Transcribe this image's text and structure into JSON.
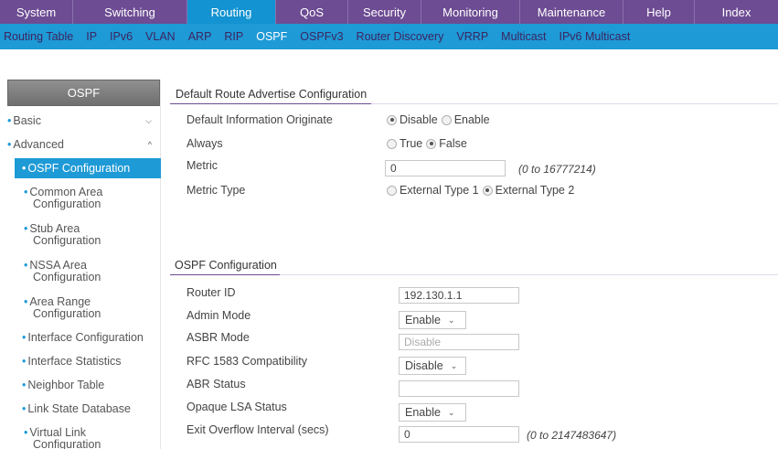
{
  "topnav": {
    "tabs": [
      {
        "label": "System",
        "width": 80,
        "active": false
      },
      {
        "label": "Switching",
        "width": 125,
        "active": false
      },
      {
        "label": "Routing",
        "width": 97,
        "active": true
      },
      {
        "label": "QoS",
        "width": 79,
        "active": false
      },
      {
        "label": "Security",
        "width": 80,
        "active": false
      },
      {
        "label": "Monitoring",
        "width": 108,
        "active": false
      },
      {
        "label": "Maintenance",
        "width": 113,
        "active": false
      },
      {
        "label": "Help",
        "width": 78,
        "active": false
      },
      {
        "label": "Index",
        "width": 91,
        "active": false
      }
    ]
  },
  "subnav": {
    "items": [
      {
        "label": "Routing Table",
        "active": false
      },
      {
        "label": "IP",
        "active": false
      },
      {
        "label": "IPv6",
        "active": false
      },
      {
        "label": "VLAN",
        "active": false
      },
      {
        "label": "ARP",
        "active": false
      },
      {
        "label": "RIP",
        "active": false
      },
      {
        "label": "OSPF",
        "active": true
      },
      {
        "label": "OSPFv3",
        "active": false
      },
      {
        "label": "Router Discovery",
        "active": false
      },
      {
        "label": "VRRP",
        "active": false
      },
      {
        "label": "Multicast",
        "active": false
      },
      {
        "label": "IPv6 Multicast",
        "active": false
      }
    ]
  },
  "sidebar": {
    "title": "OSPF",
    "basic": "Basic",
    "advanced": "Advanced",
    "items": [
      "OSPF Configuration",
      "Common Area Configuration",
      "Stub Area Configuration",
      "NSSA Area Configuration",
      "Area Range Configuration",
      "Interface Configuration",
      "Interface Statistics",
      "Neighbor Table",
      "Link State Database",
      "Virtual Link Configuration"
    ]
  },
  "default_route": {
    "title": "Default Route Advertise Configuration",
    "default_info_label": "Default Information Originate",
    "default_info_opt1": "Disable",
    "default_info_opt2": "Enable",
    "always_label": "Always",
    "always_opt1": "True",
    "always_opt2": "False",
    "metric_label": "Metric",
    "metric_value": "0",
    "metric_hint": "(0 to 16777214)",
    "metric_type_label": "Metric Type",
    "metric_type_opt1": "External Type 1",
    "metric_type_opt2": "External Type 2"
  },
  "ospf_config": {
    "title": "OSPF Configuration",
    "router_id_label": "Router ID",
    "router_id_value": "192.130.1.1",
    "admin_mode_label": "Admin Mode",
    "admin_mode_value": "Enable",
    "asbr_mode_label": "ASBR Mode",
    "asbr_mode_value": "Disable",
    "rfc_label": "RFC 1583 Compatibility",
    "rfc_value": "Disable",
    "abr_label": "ABR Status",
    "abr_value": "",
    "opaque_label": "Opaque LSA Status",
    "opaque_value": "Enable",
    "exit_overflow_label": "Exit Overflow Interval (secs)",
    "exit_overflow_value": "0",
    "exit_overflow_hint": "(0 to 2147483647)"
  }
}
